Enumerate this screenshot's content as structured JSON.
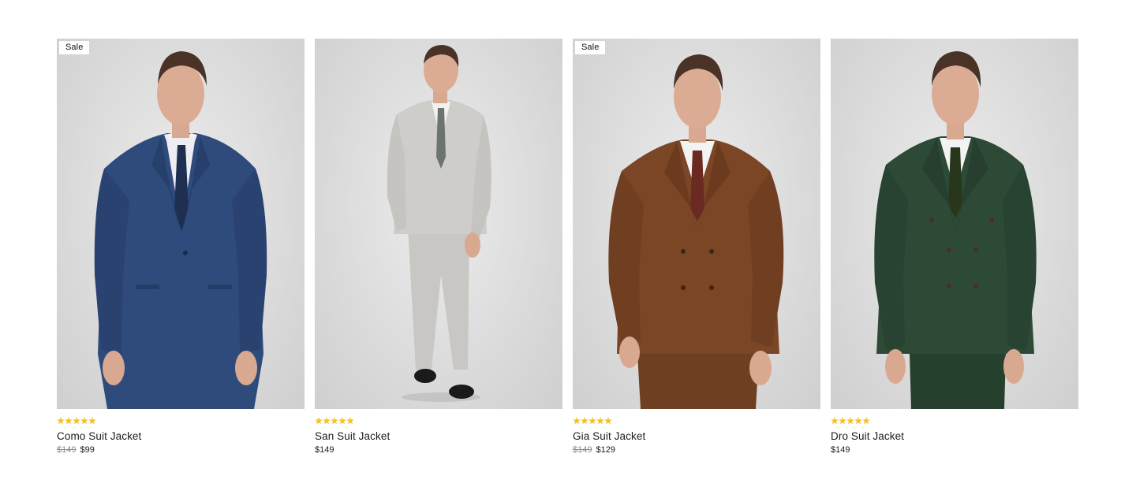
{
  "colors": {
    "star": "#f2c230",
    "badge_bg": "#ffffff",
    "old_price": "#8a8a8a"
  },
  "products": [
    {
      "badge": "Sale",
      "rating_stars": 5,
      "name": "Como Suit Jacket",
      "price_old": "$149",
      "price": "$99",
      "image_icon": "navy-suit-model-image",
      "suit_color": "#2f4b7c",
      "tie_color": "#1f2f52"
    },
    {
      "badge": "",
      "rating_stars": 5,
      "name": "San Suit Jacket",
      "price_old": "",
      "price": "$149",
      "image_icon": "light-grey-suit-model-image",
      "suit_color": "#c8c6c2",
      "tie_color": "#6d746f"
    },
    {
      "badge": "Sale",
      "rating_stars": 5,
      "name": "Gia Suit Jacket",
      "price_old": "$149",
      "price": "$129",
      "image_icon": "brown-suit-model-image",
      "suit_color": "#7a4626",
      "tie_color": "#6a2a22"
    },
    {
      "badge": "",
      "rating_stars": 5,
      "name": "Dro Suit Jacket",
      "price_old": "",
      "price": "$149",
      "image_icon": "green-suit-model-image",
      "suit_color": "#2d4a36",
      "tie_color": "#28361c"
    }
  ]
}
